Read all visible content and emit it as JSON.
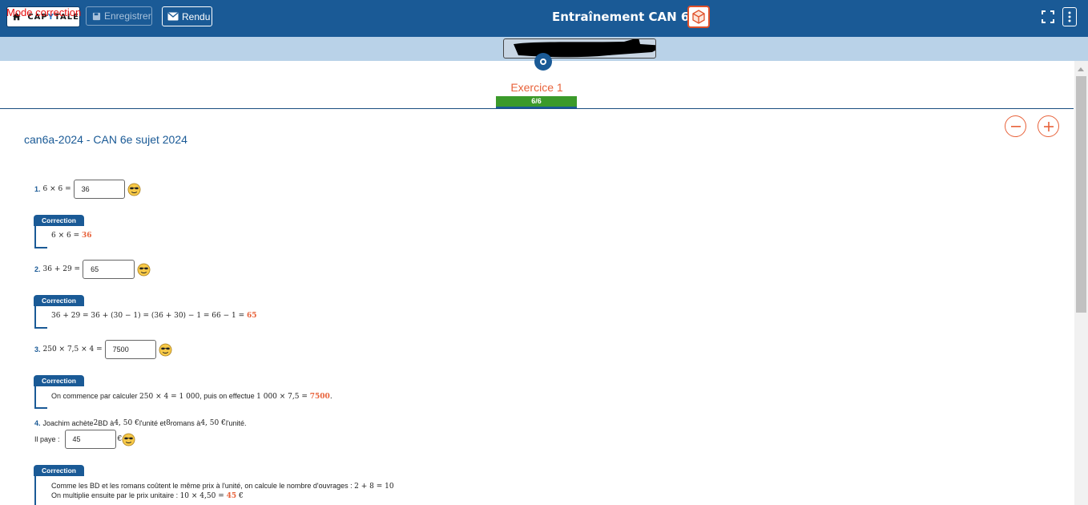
{
  "header": {
    "logo_text_a": "CAP",
    "logo_text_b": "Y",
    "logo_text_c": "TALE",
    "save_label": "Enregistrer",
    "rendu_label": "Rendu",
    "title": "Entraînement CAN 6e"
  },
  "mode_label": "Mode correction",
  "exercise": {
    "title": "Exercice 1",
    "progress": "6/6",
    "progress_fraction": 1.0
  },
  "subtitle": "can6a-2024 - CAN 6e sujet 2024",
  "questions": [
    {
      "num": "1.",
      "expr": "6 × 6 =",
      "answer": "36",
      "correction_label": "Correction",
      "correction_expr": "6 × 6 = ",
      "correction_result": "36"
    },
    {
      "num": "2.",
      "expr": "36 + 29 =",
      "answer": "65",
      "correction_label": "Correction",
      "correction_expr": "36 + 29 = 36 + (30 − 1) = (36 + 30) − 1 = 66 − 1 = ",
      "correction_result": "65"
    },
    {
      "num": "3.",
      "expr": "250 × 7,5 × 4 =",
      "answer": "7500",
      "correction_label": "Correction",
      "correction_pre": "On commence par calculer ",
      "correction_mid1": "250 × 4 = 1 000",
      "correction_mid2": ", puis on effectue ",
      "correction_mid3": "1 000 × 7,5 = ",
      "correction_result": "7500",
      "correction_end": "."
    },
    {
      "num": "4.",
      "text_a": "Joachim achète ",
      "text_b": "2",
      "text_c": " BD à ",
      "text_d": "4, 50 €",
      "text_e": "  l'unité et ",
      "text_f": "8",
      "text_g": " romans à ",
      "text_h": "4, 50 €",
      "text_i": "  l'unité.",
      "pays_label": "Il paye :",
      "answer": "45",
      "unit": "€",
      "correction_label": "Correction",
      "correction_line1_a": "Comme les BD et les romans coûtent le même prix à l'unité, on calcule le nombre d'ouvrages : ",
      "correction_line1_b": "2 + 8 = 10",
      "correction_line2_a": "On multiplie ensuite par le prix unitaire : ",
      "correction_line2_b": "10 × 4,50 = ",
      "correction_result": "45",
      "correction_line2_c": " €"
    }
  ],
  "colors": {
    "topbar": "#1a5a96",
    "modebar": "#b9d2e8",
    "accent": "#e8623a",
    "progress": "#3b9a2a"
  }
}
